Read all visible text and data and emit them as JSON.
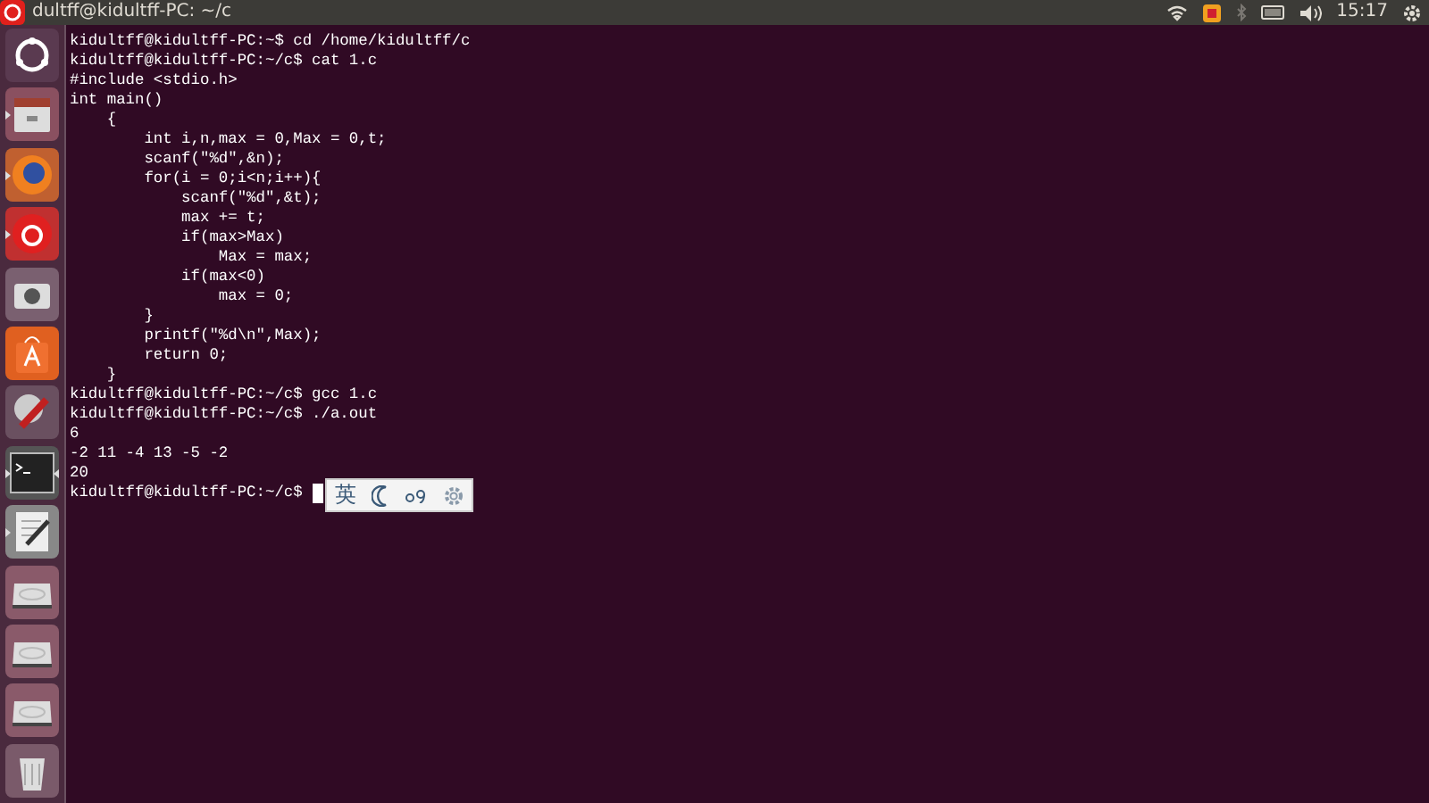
{
  "top_bar": {
    "title": "dultff@kidultff-PC: ~/c",
    "clock": "15:17"
  },
  "launcher": [
    {
      "kind": "dash",
      "running": false,
      "focused": false
    },
    {
      "kind": "files",
      "running": true,
      "focused": false
    },
    {
      "kind": "firefox",
      "running": true,
      "focused": false
    },
    {
      "kind": "music",
      "running": true,
      "focused": false
    },
    {
      "kind": "camera",
      "running": false,
      "focused": false
    },
    {
      "kind": "store",
      "running": false,
      "focused": false
    },
    {
      "kind": "settings",
      "running": false,
      "focused": false
    },
    {
      "kind": "terminal",
      "running": true,
      "focused": true
    },
    {
      "kind": "editor",
      "running": true,
      "focused": false
    },
    {
      "kind": "drive",
      "running": false,
      "focused": false
    },
    {
      "kind": "drive",
      "running": false,
      "focused": false
    },
    {
      "kind": "drive",
      "running": false,
      "focused": false
    },
    {
      "kind": "trash",
      "running": false,
      "focused": false
    }
  ],
  "terminal": {
    "lines": [
      "kidultff@kidultff-PC:~$ cd /home/kidultff/c",
      "kidultff@kidultff-PC:~/c$ cat 1.c",
      "#include <stdio.h>",
      "int main()",
      "    {",
      "        int i,n,max = 0,Max = 0,t;",
      "        scanf(\"%d\",&n);",
      "        for(i = 0;i<n;i++){",
      "            scanf(\"%d\",&t);",
      "            max += t;",
      "            if(max>Max)",
      "                Max = max;",
      "            if(max<0)",
      "                max = 0;",
      "        }",
      "        printf(\"%d\\n\",Max);",
      "        return 0;",
      "    }",
      "kidultff@kidultff-PC:~/c$ gcc 1.c",
      "kidultff@kidultff-PC:~/c$ ./a.out",
      "6",
      "-2 11 -4 13 -5 -2",
      "20",
      "kidultff@kidultff-PC:~/c$ "
    ]
  },
  "ime_bar": {
    "mode": "英"
  }
}
